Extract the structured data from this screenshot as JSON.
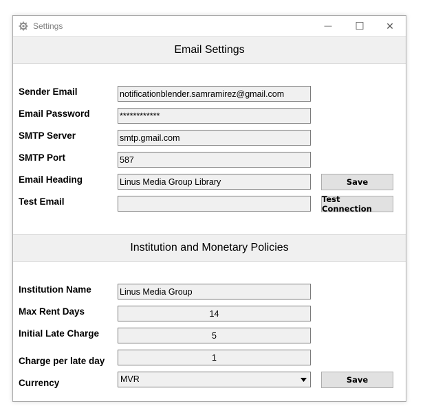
{
  "window": {
    "title": "Settings",
    "app_icon": "gear-icon",
    "minimize_glyph": "—",
    "maximize_glyph": "☐",
    "close_glyph": "✕"
  },
  "email_section": {
    "heading": "Email Settings",
    "sender_email_label": "Sender Email",
    "sender_email_value": "notificationblender.samramirez@gmail.com",
    "password_label": "Email Password",
    "password_value": "************",
    "smtp_server_label": "SMTP Server",
    "smtp_server_value": "smtp.gmail.com",
    "smtp_port_label": "SMTP Port",
    "smtp_port_value": "587",
    "heading_label": "Email Heading",
    "heading_value": "Linus Media Group Library",
    "test_email_label": "Test Email",
    "test_email_value": "",
    "save_label": "Save",
    "test_connection_label": "Test Connection"
  },
  "policy_section": {
    "heading": "Institution and Monetary Policies",
    "institution_label": "Institution Name",
    "institution_value": "Linus Media Group",
    "max_rent_label": "Max Rent Days",
    "max_rent_value": "14",
    "initial_late_label": "Initial Late Charge",
    "initial_late_value": "5",
    "per_day_label": "Charge per late day",
    "per_day_value": "1",
    "currency_label": "Currency",
    "currency_value": "MVR",
    "save_label": "Save"
  }
}
